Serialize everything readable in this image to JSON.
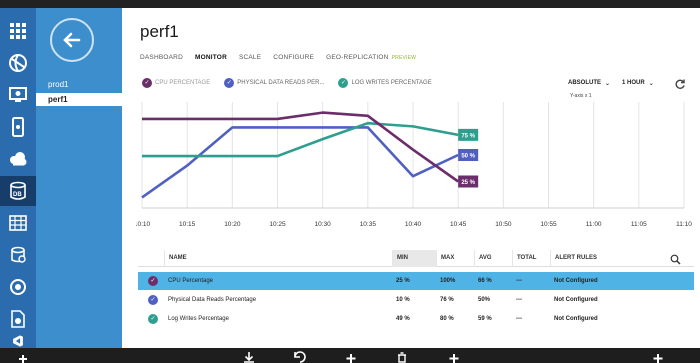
{
  "nav": {
    "items": [
      "prod1",
      "perf1"
    ]
  },
  "page": {
    "title": "perf1"
  },
  "tabs": [
    {
      "label": "DASHBOARD",
      "active": false
    },
    {
      "label": "MONITOR",
      "active": true
    },
    {
      "label": "SCALE",
      "active": false
    },
    {
      "label": "CONFIGURE",
      "active": false
    },
    {
      "label": "GEO-REPLICATION",
      "active": false
    }
  ],
  "tab_preview_badge": "PREVIEW",
  "legend": [
    {
      "label": "CPU PERCENTAGE",
      "color": "#6b2e6b",
      "muted": true
    },
    {
      "label": "PHYSICAL DATA READS PER...",
      "color": "#5060c0"
    },
    {
      "label": "LOG WRITES PERCENTAGE",
      "color": "#2f9e8f"
    }
  ],
  "controls": {
    "scale": "ABSOLUTE",
    "range": "1 HOUR",
    "scale_note": "Y-axis x 1"
  },
  "chart_data": {
    "type": "line",
    "x": [
      "10:10",
      "10:15",
      "10:20",
      "10:25",
      "10:30",
      "10:35",
      "10:40",
      "10:45",
      "10:50",
      "10:55",
      "11:00",
      "11:05",
      "11:10"
    ],
    "ylim": [
      0,
      100
    ],
    "series": [
      {
        "name": "CPU Percentage",
        "color": "#6b2e6b",
        "values": [
          84,
          84,
          84,
          84,
          90,
          87,
          55,
          25,
          null,
          null,
          null,
          null,
          null
        ],
        "end_label": "25 %"
      },
      {
        "name": "Physical Data Reads Percentage",
        "color": "#5060c0",
        "values": [
          10,
          40,
          76,
          76,
          76,
          76,
          30,
          50,
          null,
          null,
          null,
          null,
          null
        ],
        "end_label": "50 %"
      },
      {
        "name": "Log Writes Percentage",
        "color": "#2f9e8f",
        "values": [
          49,
          49,
          49,
          49,
          65,
          80,
          77,
          69,
          null,
          null,
          null,
          null,
          null
        ],
        "end_label": "75 %"
      }
    ]
  },
  "grid": {
    "headers": [
      "NAME",
      "MIN",
      "MAX",
      "AVG",
      "TOTAL",
      "ALERT RULES"
    ],
    "rows": [
      {
        "name": "CPU Percentage",
        "min": "25 %",
        "max": "100%",
        "avg": "66 %",
        "total": "---",
        "alert": "Not Configured",
        "color": "#6b2e6b",
        "selected": true
      },
      {
        "name": "Physical Data Reads Percentage",
        "min": "10 %",
        "max": "76 %",
        "avg": "50%",
        "total": "---",
        "alert": "Not Configured",
        "color": "#5060c0",
        "selected": false
      },
      {
        "name": "Log Writes Percentage",
        "min": "49 %",
        "max": "80 %",
        "avg": "59 %",
        "total": "---",
        "alert": "Not Configured",
        "color": "#2f9e8f",
        "selected": false
      }
    ]
  },
  "iconbar": [
    "all-items-icon",
    "web-sites-icon",
    "virtual-machines-icon",
    "mobile-services-icon",
    "cloud-services-icon",
    "sql-databases-icon",
    "storage-icon",
    "hdinsight-icon",
    "media-services-icon",
    "service-bus-icon",
    "visual-studio-icon"
  ]
}
